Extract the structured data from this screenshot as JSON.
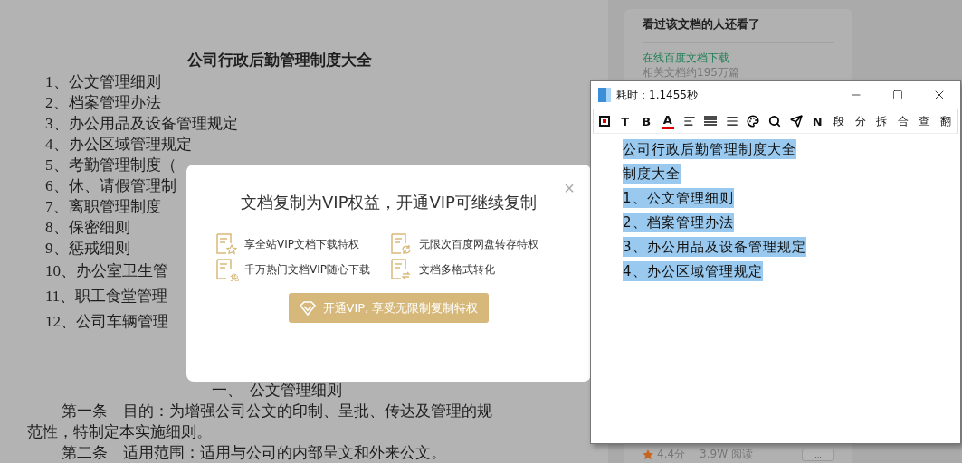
{
  "document": {
    "title": "公司行政后勤管理制度大全",
    "toc": [
      "1、公文管理细则",
      "2、档案管理办法",
      "3、办公用品及设备管理规定",
      "4、办公区域管理规定",
      "5、考勤管理制度（",
      "6、休、请假管理制",
      "7、离职管理制度",
      "8、保密细则",
      "9、惩戒细则",
      "10、办公室卫生管",
      "11、职工食堂管理",
      "12、公司车辆管理"
    ],
    "section_heading": "一、  公文管理细则",
    "paragraphs": [
      {
        "lines": [
          "第一条　目的：为增强公司公文的印制、呈批、传达及管理的规",
          "范性，特制定本实施细则。"
        ]
      },
      {
        "lines": [
          "第二条　适用范围：适用与公司的内部呈文和外来公文。"
        ]
      }
    ]
  },
  "sidebar": {
    "heading": "看过该文档的人还看了",
    "link": "在线百度文档下载",
    "subtext": "相关文档约195万篇",
    "rating": "4.4分",
    "reads": "3.9W 阅读",
    "more_button": "..."
  },
  "modal": {
    "title": "文档复制为VIP权益，开通VIP可继续复制",
    "close": "×",
    "features": [
      {
        "kind": "star",
        "label": "享全站VIP文档下载特权"
      },
      {
        "kind": "refresh",
        "label": "无限次百度网盘转存特权"
      },
      {
        "kind": "free",
        "label": "千万热门文档VIP随心下载",
        "badge": "免"
      },
      {
        "kind": "convert",
        "label": "文档多格式转化"
      }
    ],
    "cta": "开通VIP, 享受无限制复制特权"
  },
  "ocr_window": {
    "title": "耗时：1.1455秒",
    "toolbar": [
      {
        "kind": "icon"
      },
      {
        "kind": "text",
        "label": "T"
      },
      {
        "kind": "text",
        "label": "B"
      },
      {
        "kind": "color",
        "label": "A",
        "color": "#e00000"
      },
      {
        "kind": "icon"
      },
      {
        "kind": "icon"
      },
      {
        "kind": "icon"
      },
      {
        "kind": "icon"
      },
      {
        "kind": "icon"
      },
      {
        "kind": "icon"
      },
      {
        "kind": "text",
        "label": "N"
      },
      {
        "kind": "char",
        "label": "段"
      },
      {
        "kind": "char",
        "label": "分"
      },
      {
        "kind": "char",
        "label": "拆"
      },
      {
        "kind": "char",
        "label": "合"
      },
      {
        "kind": "char",
        "label": "查"
      },
      {
        "kind": "char",
        "label": "翻"
      }
    ],
    "lines": [
      {
        "text": "公司行政后勤管理制度大全",
        "selected": true
      },
      {
        "text": "制度大全",
        "selected": true
      },
      {
        "text": "1、公文管理细则",
        "selected": true
      },
      {
        "text": "2、档案管理办法",
        "selected": true
      },
      {
        "text": "3、办公用品及设备管理规定",
        "selected": true
      },
      {
        "text": "4、办公区域管理规定",
        "selected": true
      }
    ]
  }
}
